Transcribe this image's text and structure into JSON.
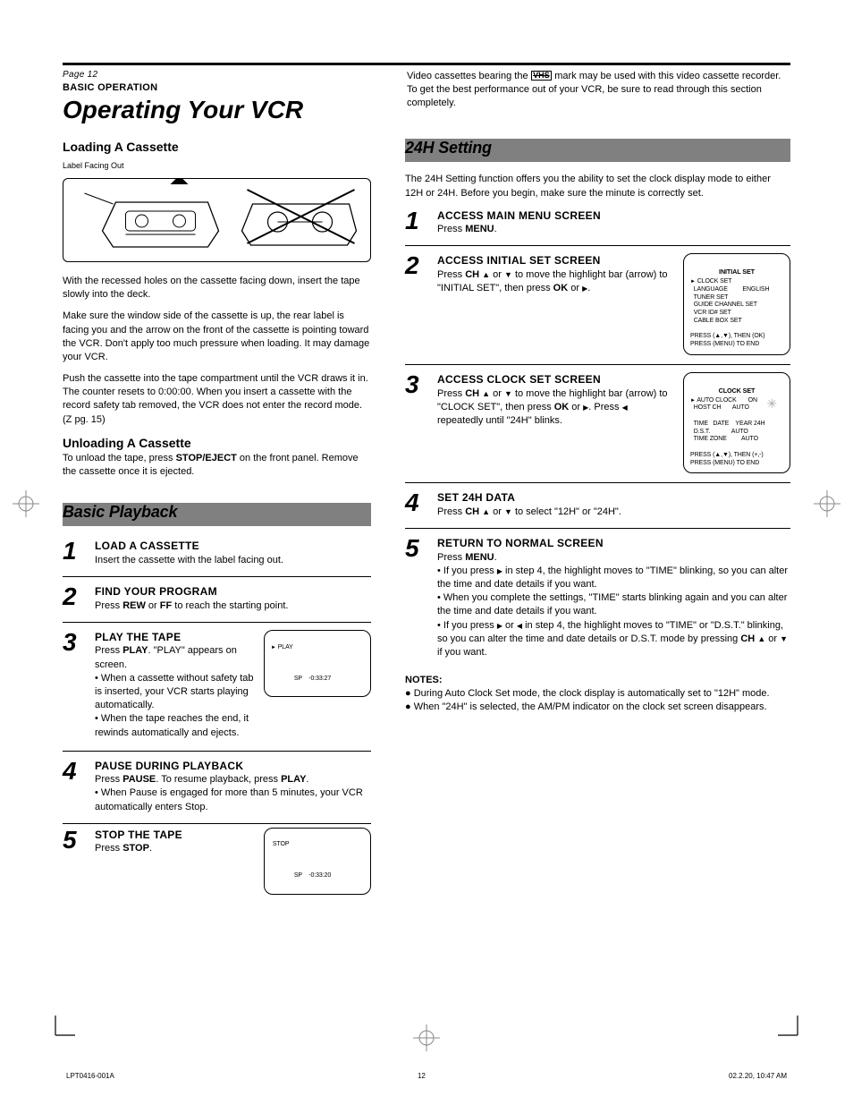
{
  "header": {
    "page_no": "Page 12",
    "super": "BASIC OPERATION",
    "title": "Operating Your VCR",
    "vhs_intro": "Video cassettes bearing the",
    "vhs_logo": "VHS",
    "vhs_after": "mark may be used with this video cassette recorder. To get the best performance out of your VCR, be sure to read through this section completely."
  },
  "left": {
    "loading_title": "Loading A Cassette",
    "label_front": "Label Facing Out",
    "loading_p1": "With the recessed holes on the cassette facing down, insert the tape slowly into the deck.",
    "loading_p2": "Make sure the window side of the cassette is up, the rear label is facing you and the arrow on the front of the cassette is pointing toward the VCR. Don't apply too much pressure when loading. It may damage your VCR.",
    "loading_p3_a": "Push the cassette into the tape compartment until the VCR draws it in. The counter resets to 0:00:00. When you insert a cassette with the record safety tab removed, the VCR does not enter the record mode. (",
    "loading_p3_ref": "Z pg. 15",
    "loading_p3_b": ")",
    "unload_title": "Unloading A Cassette",
    "unload_text_a": "To unload the tape, press ",
    "unload_text_b": "STOP/EJECT",
    "unload_text_c": " on the front panel. Remove the cassette once it is ejected.",
    "bar_title": "Basic Playback",
    "step1_head": "LOAD A CASSETTE",
    "step1_text": "Insert the cassette with the label facing out.",
    "step2_head": "FIND YOUR PROGRAM",
    "step2_text_a": "Press ",
    "step2_text_b": "REW",
    "step2_text_c": " or ",
    "step2_text_d": "FF",
    "step2_text_e": " to reach the starting point.",
    "step3_head": "PLAY THE TAPE",
    "step3_text_a": "Press ",
    "step3_text_b": "PLAY",
    "step3_text_c": ". \"PLAY\" appears on screen.",
    "step3_bullet_a": "• When a cassette without safety tab is inserted, your VCR starts playing automatically.",
    "step3_bullet_b": "• When the tape reaches the end, it rewinds automatically and ejects.",
    "step4_head": "PAUSE DURING PLAYBACK",
    "step4_text_a": "Press ",
    "step4_text_b": "PAUSE",
    "step4_text_c": ". To resume playback, press ",
    "step4_text_d": "PLAY",
    "step4_text_e": ".",
    "step4_bullet": "• When Pause is engaged for more than 5 minutes, your VCR automatically enters Stop.",
    "step5_head": "STOP THE TAPE",
    "step5_text_a": "Press ",
    "step5_text_b": "STOP",
    "step5_text_c": "."
  },
  "right": {
    "bar_title": "24H Setting",
    "intro": "The 24H Setting function offers you the ability to set the clock display mode to either 12H or 24H. Before you begin, make sure the minute is correctly set.",
    "step1_head": "ACCESS MAIN MENU SCREEN",
    "step1_text_a": "Press ",
    "step1_text_b": "MENU",
    "step1_text_c": ".",
    "step2_head": "ACCESS INITIAL SET SCREEN",
    "step2_text_a": "Press ",
    "step2_text_b": "CH",
    "step2_text_c": " or ",
    "step2_text_d": " to move the highlight bar (arrow) to \"INITIAL SET\", then press ",
    "step2_text_e": "OK",
    "step2_text_f": " or ",
    "step2_text_g": ".",
    "step3_head": "ACCESS CLOCK SET SCREEN",
    "step3_text_a": "Press ",
    "step3_text_b": "CH",
    "step3_text_c": " or ",
    "step3_text_d": " to move the highlight bar (arrow) to \"CLOCK SET\", then press ",
    "step3_text_e": "OK",
    "step3_text_f": " or ",
    "step3_text_g": ". Press ",
    "step3_text_h": " repeatedly until \"24H\" blinks.",
    "step4_head": "SET 24H DATA",
    "step4_text_a": "Press ",
    "step4_text_b": "CH",
    "step4_text_c": " or ",
    "step4_text_d": " to select \"12H\" or \"24H\".",
    "step5_head": "RETURN TO NORMAL SCREEN",
    "step5_text_a": "Press ",
    "step5_text_b": "MENU",
    "step5_text_c": ".",
    "step5_bullet_a": "• If you press ",
    "step5_bullet_b": " in step 4, the highlight moves to \"TIME\" blinking, so you can alter the time and date details if you want.",
    "step5_bullet_c": "• When you complete the settings, \"TIME\" starts blinking again and you can alter the time and date details if you want.",
    "step5_bullet_d_a": "• If you press ",
    "step5_bullet_d_b": " or ",
    "step5_bullet_d_c": " in step 4, the highlight moves to \"TIME\" or \"D.S.T.\" blinking, so you can alter the time and date details or D.S.T. mode by pressing ",
    "step5_bullet_d_d": "CH",
    "step5_bullet_d_e": " or ",
    "step5_bullet_d_f": " if you want.",
    "notes_head": "NOTES:",
    "note1": "During Auto Clock Set mode, the clock display is automatically set to \"12H\" mode.",
    "note2": "When \"24H\" is selected, the AM/PM indicator on the clock set screen disappears."
  },
  "osd": {
    "initial": {
      "title": "INITIAL SET",
      "items": [
        "CLOCK SET",
        "LANGUAGE         ENGLISH",
        "TUNER SET",
        "GUIDE CHANNEL SET",
        "VCR ID# SET",
        "CABLE BOX SET"
      ],
      "hint1": "PRESS (▲,▼), THEN (OK)",
      "hint2": "PRESS (MENU) TO END"
    },
    "clock": {
      "title": "CLOCK SET",
      "lines": [
        "AUTO CLOCK       ON",
        "HOST CH       AUTO",
        "",
        "TIME   DATE    YEAR 24H",
        "D.S.T.             AUTO",
        "TIME ZONE         AUTO"
      ],
      "hint1": "PRESS (▲,▼), THEN (+,-)",
      "hint2": "PRESS (MENU) TO END"
    },
    "play_label": "PLAY",
    "stop_label": "STOP",
    "counter1": "-0:33:27",
    "counter2": "-0:33:20",
    "sp": "SP"
  },
  "footer": {
    "left": "LPT0416-001A",
    "right": "02.2.20, 10:47 AM",
    "page": "12"
  }
}
